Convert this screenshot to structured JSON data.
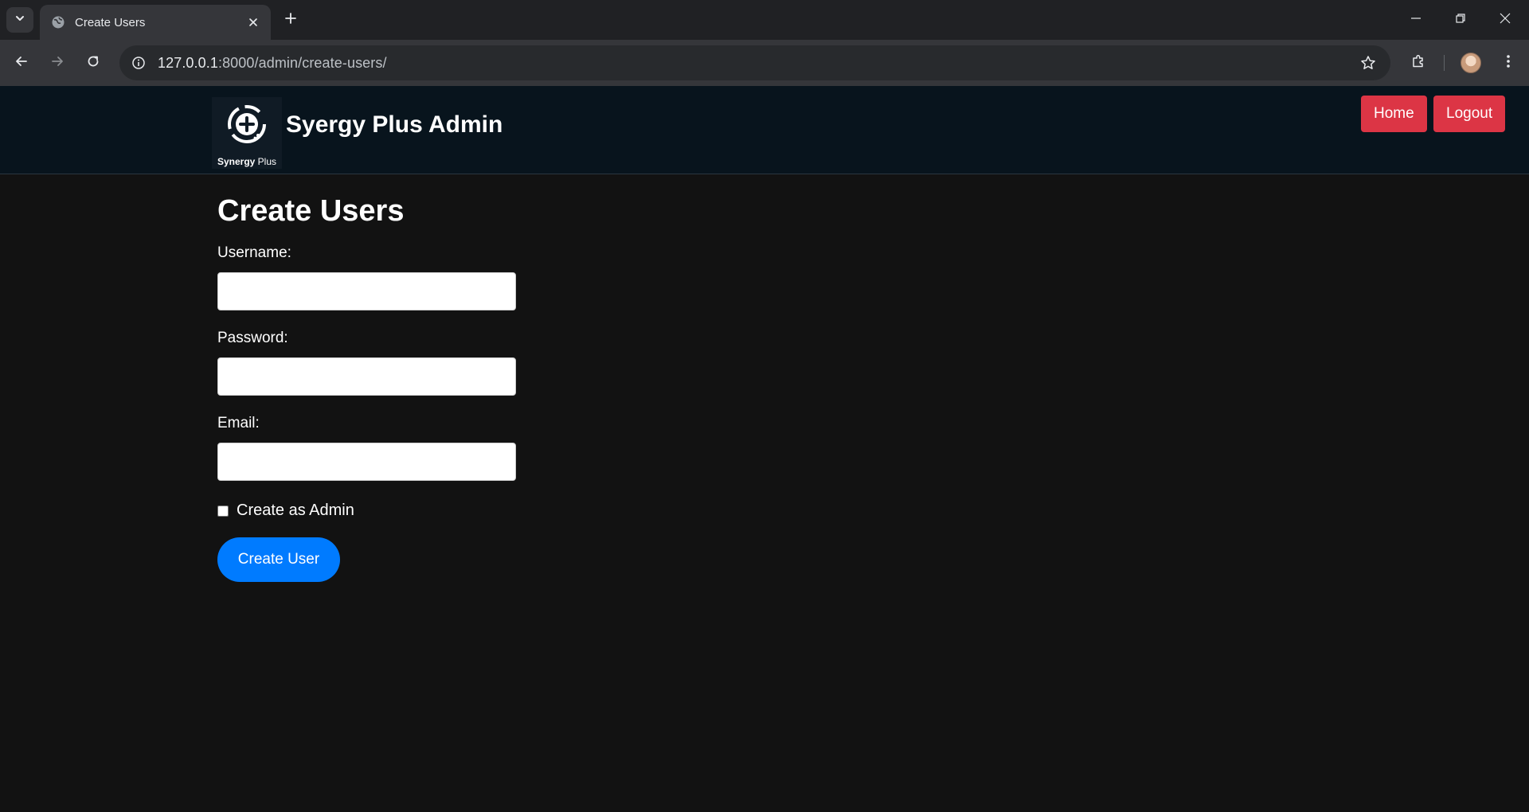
{
  "browser": {
    "tab_title": "Create Users",
    "url_host": "127.0.0.1",
    "url_path": ":8000/admin/create-users/"
  },
  "header": {
    "logo_caption_bold": "Synergy",
    "logo_caption_light": "Plus",
    "site_title": "Syergy Plus Admin",
    "home_label": "Home",
    "logout_label": "Logout",
    "button_color": "#dc3545"
  },
  "form": {
    "title": "Create Users",
    "username_label": "Username:",
    "username_value": "",
    "password_label": "Password:",
    "password_value": "",
    "email_label": "Email:",
    "email_value": "",
    "admin_checkbox_label": "Create as Admin",
    "admin_checked": false,
    "submit_label": "Create User",
    "submit_color": "#007bff"
  }
}
